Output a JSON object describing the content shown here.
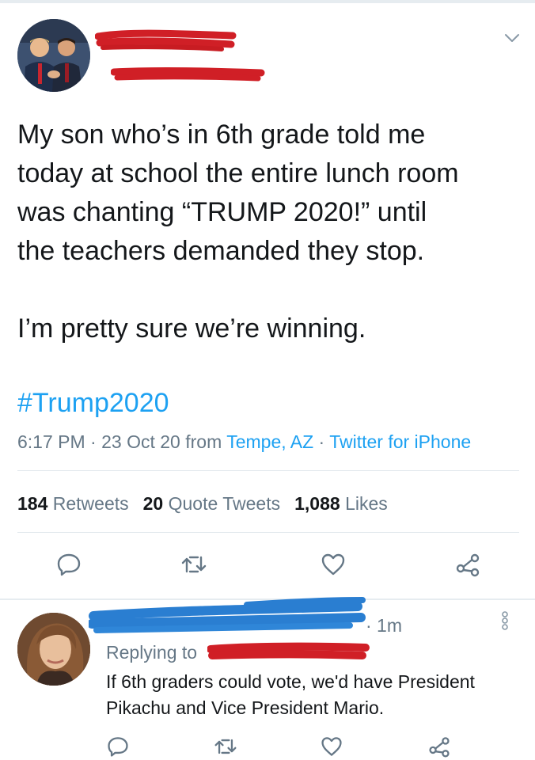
{
  "tweet": {
    "text": "My son who’s in 6th grade told me\ntoday at school the entire lunch room\nwas chanting “TRUMP 2020!” until\nthe teachers demanded they stop.\n\nI’m pretty sure we’re winning.",
    "hashtag": "#Trump2020",
    "time": "6:17 PM",
    "date": "23 Oct 20",
    "from_label": "from",
    "location": "Tempe, AZ",
    "client": "Twitter for iPhone",
    "separator": "·",
    "retweets_count": "184",
    "retweets_label": "Retweets",
    "quotes_count": "20",
    "quotes_label": "Quote Tweets",
    "likes_count": "1,088",
    "likes_label": "Likes"
  },
  "reply": {
    "time": "· 1m",
    "replying_label": "Replying to",
    "text": "If 6th graders could vote, we'd have President\nPikachu and Vice President Mario."
  },
  "icons": {
    "reply": "reply-icon",
    "retweet": "retweet-icon",
    "like": "heart-icon",
    "share": "share-icon",
    "more": "more-vertical-icon",
    "chevron": "chevron-down-icon"
  },
  "colors": {
    "link": "#1da1f2",
    "muted": "#657786",
    "text": "#14171a",
    "redaction_red": "#d01f26",
    "redaction_blue": "#2a7ed1"
  }
}
